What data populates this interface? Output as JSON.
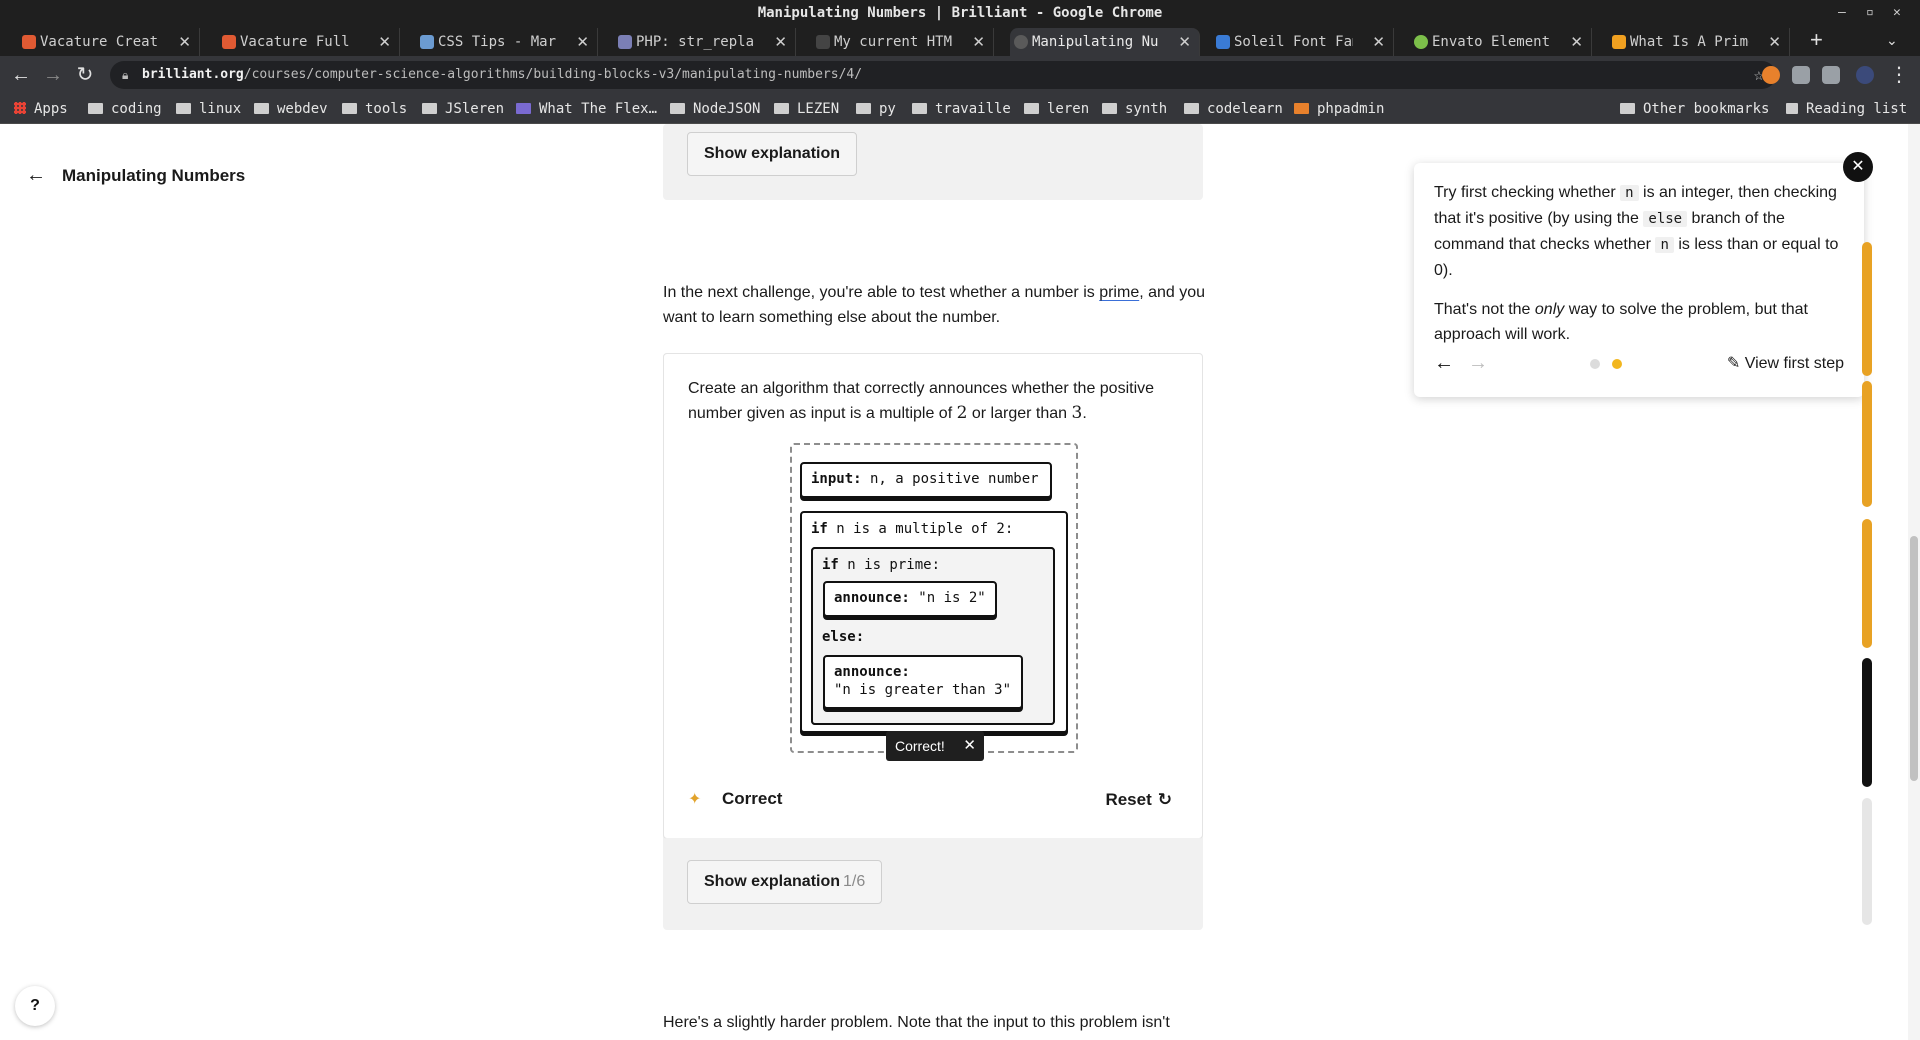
{
  "window": {
    "title": "Manipulating Numbers | Brilliant - Google Chrome",
    "min": "–",
    "max": "▫",
    "close": "✕"
  },
  "tabs": [
    {
      "label": "Vacature Creatie",
      "color": "#e05a33"
    },
    {
      "label": "Vacature Full sta",
      "color": "#e05a33"
    },
    {
      "label": "CSS Tips - Marko",
      "color": "#6b9bd1"
    },
    {
      "label": "PHP: str_replace",
      "color": "#7b7fb5"
    },
    {
      "label": "My current HTML",
      "color": "#444"
    },
    {
      "label": "Manipulating Numb",
      "color": "#5a5a5a"
    },
    {
      "label": "Soleil Font Famil",
      "color": "#3a7bd5"
    },
    {
      "label": "Envato Elements:",
      "color": "#7cbf4a"
    },
    {
      "label": "What Is A Prime",
      "color": "#f0a020"
    }
  ],
  "new_tab": "+",
  "nav": {
    "back": "←",
    "forward": "→",
    "reload": "↻"
  },
  "omnibox": {
    "host": "brilliant.org",
    "path": "/courses/computer-science-algorithms/building-blocks-v3/manipulating-numbers/4/"
  },
  "bookmarks": [
    {
      "label": "Apps",
      "kind": "grid"
    },
    {
      "label": "coding",
      "kind": "folder"
    },
    {
      "label": "linux",
      "kind": "folder"
    },
    {
      "label": "webdev",
      "kind": "folder"
    },
    {
      "label": "tools",
      "kind": "folder"
    },
    {
      "label": "JSleren",
      "kind": "folder"
    },
    {
      "label": "What The Flex…",
      "kind": "site"
    },
    {
      "label": "NodeJSON",
      "kind": "folder"
    },
    {
      "label": "LEZEN",
      "kind": "folder"
    },
    {
      "label": "py",
      "kind": "folder"
    },
    {
      "label": "travaille",
      "kind": "folder"
    },
    {
      "label": "leren",
      "kind": "folder"
    },
    {
      "label": "synth",
      "kind": "folder"
    },
    {
      "label": "codelearn",
      "kind": "folder"
    },
    {
      "label": "phpadmin",
      "kind": "site"
    }
  ],
  "bookmarks_right": {
    "other": "Other bookmarks",
    "reading": "Reading list"
  },
  "page": {
    "back_label": "Manipulating Numbers",
    "show_explanation": "Show explanation",
    "intro_before": "In the next challenge, you're able to test whether a number is ",
    "intro_link": "prime",
    "intro_after": ", and you want to learn something else about the number.",
    "problem_a": "Create an algorithm that correctly announces whether the positive number given as input is a multiple of ",
    "problem_n2": "2",
    "problem_b": " or larger than ",
    "problem_n3": "3",
    "problem_c": ".",
    "blocks": {
      "input_kw": "input:",
      "input_txt": " n, a positive number",
      "if1_kw": "if",
      "if1_txt": " n is a multiple of 2:",
      "if2_kw": "if",
      "if2_txt": " n is prime:",
      "ann1_kw": "announce:",
      "ann1_txt": " \"n is 2\"",
      "else_kw": "else:",
      "ann2_kw": "announce:",
      "ann2_txt": "\"n is greater than 3\""
    },
    "toast": "Correct!",
    "result": "Correct",
    "reset": "Reset",
    "show_explanation_2": "Show explanation",
    "explanation_count": "1/6",
    "bottom_text": "Here's a slightly harder problem. Note that the input to this problem isn't"
  },
  "hint": {
    "p1_a": "Try first checking whether ",
    "p1_code1": "n",
    "p1_b": " is an integer, then checking that it's positive (by using the ",
    "p1_code2": "else",
    "p1_c": " branch of the command that checks whether ",
    "p1_code3": "n",
    "p1_d": " is less than or equal to 0).",
    "p2_a": "That's not the ",
    "p2_em": "only",
    "p2_b": " way to solve the problem, but that approach will work.",
    "view_first_step": "View first step"
  },
  "progress_colors": [
    "#e8a224",
    "#e8a224",
    "#e8a224",
    "#111111",
    "#e6e6e6"
  ],
  "help": "?"
}
